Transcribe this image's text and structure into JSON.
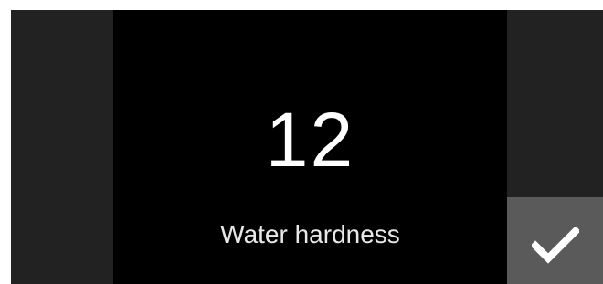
{
  "setting": {
    "value": "12",
    "label": "Water hardness"
  },
  "actions": {
    "confirm_icon": "checkmark-icon"
  },
  "colors": {
    "background": "#000000",
    "side_panel": "#222222",
    "confirm_button": "#5a5a5a",
    "text": "#ffffff"
  }
}
